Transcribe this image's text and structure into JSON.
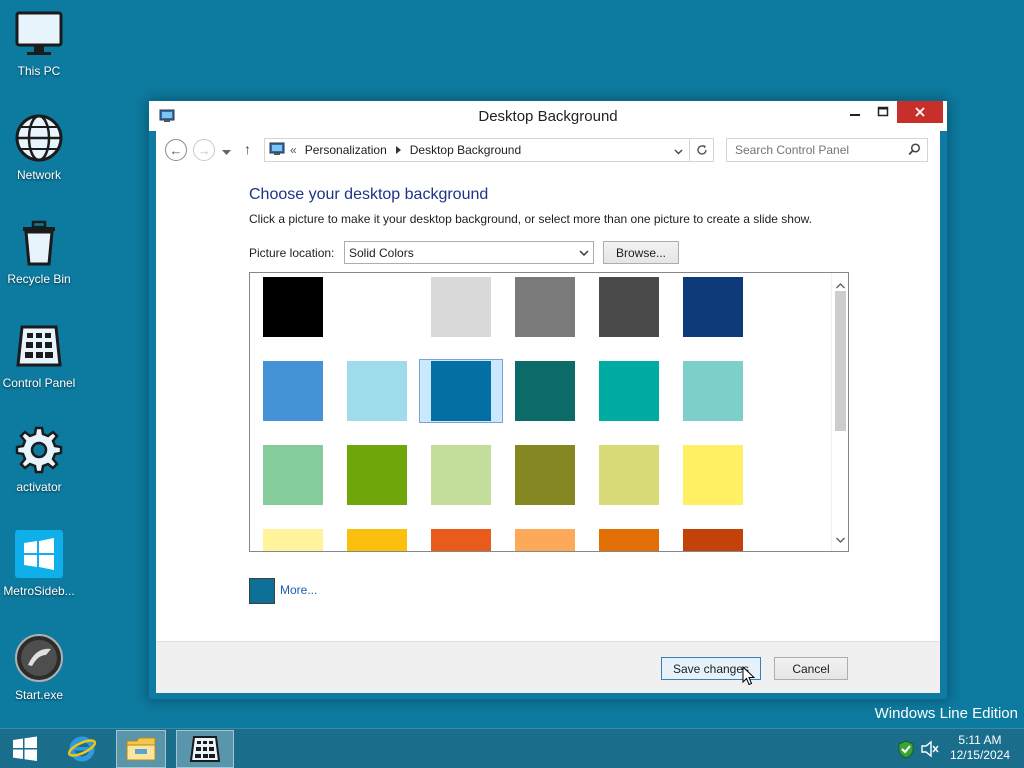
{
  "desktop": {
    "icons": [
      {
        "label": "This PC",
        "icon": "computer-icon"
      },
      {
        "label": "Network",
        "icon": "globe-icon"
      },
      {
        "label": "Recycle Bin",
        "icon": "recycle-bin-icon"
      },
      {
        "label": "Control Panel",
        "icon": "control-panel-icon"
      },
      {
        "label": "activator",
        "icon": "gear-icon"
      },
      {
        "label": "MetroSideb...",
        "icon": "windows-logo-icon"
      },
      {
        "label": "Start.exe",
        "icon": "start-orb-icon"
      }
    ],
    "edition_text": "Windows Line Edition",
    "background_color": "#0d7a9f"
  },
  "window": {
    "title": "Desktop Background",
    "address": {
      "chevrons": "«",
      "crumbs": [
        "Personalization",
        "Desktop Background"
      ]
    },
    "search_placeholder": "Search Control Panel",
    "heading": "Choose your desktop background",
    "subtitle": "Click a picture to make it your desktop background, or select more than one picture to create a slide show.",
    "picture_location_label": "Picture location:",
    "picture_location_value": "Solid Colors",
    "browse_label": "Browse...",
    "swatches": [
      "#000000",
      "#ffffff",
      "#d9d9d9",
      "#7a7a7a",
      "#4a4a4a",
      "#0e3a79",
      "#4393d6",
      "#9fdbea",
      "#046fa3",
      "#0c6a69",
      "#00aba3",
      "#7dd0c9",
      "#85cc9b",
      "#6fa60a",
      "#c3de9b",
      "#858822",
      "#d9db79",
      "#fff064",
      "#fff39c",
      "#fbbf0e",
      "#e85b1b",
      "#fda95a",
      "#e26f06",
      "#c3420a"
    ],
    "selected_swatch_index": 8,
    "more_label": "More...",
    "more_color": "#0e6f99",
    "save_label": "Save changes",
    "cancel_label": "Cancel"
  },
  "taskbar": {
    "time": "5:11 AM",
    "date": "12/15/2024",
    "items": [
      "start-button",
      "internet-explorer-icon",
      "file-explorer-icon",
      "control-panel-icon"
    ]
  }
}
